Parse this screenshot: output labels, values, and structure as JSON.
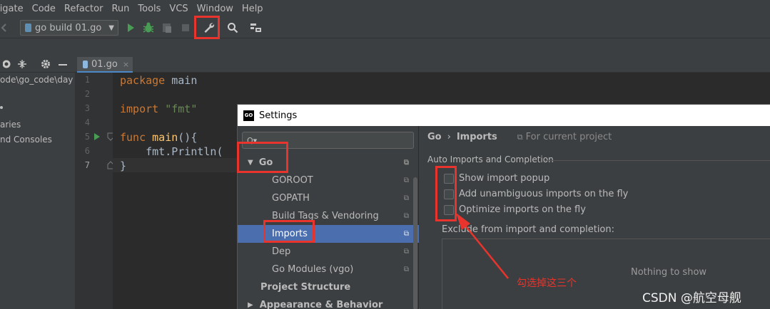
{
  "menu": {
    "items": [
      "vigate",
      "Code",
      "Refactor",
      "Run",
      "Tools",
      "VCS",
      "Window",
      "Help"
    ]
  },
  "toolbar": {
    "run_config_label": "go build 01.go",
    "icons": [
      "run-icon",
      "debug-icon",
      "coverage-icon",
      "stop-icon",
      "wrench-icon",
      "search-icon",
      "structure-icon"
    ]
  },
  "editor_tab": {
    "label": "01.go"
  },
  "project_panel": {
    "path": "ode\\go_code\\day",
    "items": [
      "aries",
      "nd Consoles"
    ]
  },
  "editor": {
    "lines": [
      {
        "num": "1",
        "tokens": [
          {
            "t": "package",
            "c": "kw"
          },
          {
            "t": " main",
            "c": ""
          }
        ]
      },
      {
        "num": "2",
        "tokens": []
      },
      {
        "num": "3",
        "tokens": [
          {
            "t": "import",
            "c": "kw"
          },
          {
            "t": " ",
            "c": ""
          },
          {
            "t": "\"fmt\"",
            "c": "str"
          }
        ]
      },
      {
        "num": "4",
        "tokens": []
      },
      {
        "num": "5",
        "tokens": [
          {
            "t": "func",
            "c": "kw"
          },
          {
            "t": " ",
            "c": ""
          },
          {
            "t": "main",
            "c": "fn"
          },
          {
            "t": "(){",
            "c": ""
          }
        ]
      },
      {
        "num": "6",
        "tokens": [
          {
            "t": "    fmt.Println(",
            "c": ""
          }
        ]
      },
      {
        "num": "7",
        "tokens": [
          {
            "t": "}",
            "c": ""
          }
        ]
      }
    ]
  },
  "dialog": {
    "title": "Settings",
    "search_placeholder": "Q▾",
    "tree": [
      {
        "label": "Go",
        "expanded": true
      },
      {
        "label": "GOROOT"
      },
      {
        "label": "GOPATH"
      },
      {
        "label": "Build Tags & Vendoring"
      },
      {
        "label": "Imports",
        "selected": true
      },
      {
        "label": "Dep"
      },
      {
        "label": "Go Modules (vgo)"
      },
      {
        "label": "Project Structure"
      },
      {
        "label": "Appearance & Behavior"
      }
    ],
    "breadcrumb": {
      "parent": "Go",
      "separator": "›",
      "current": "Imports",
      "scope": "For current project"
    },
    "section_title": "Auto Imports and Completion",
    "options": [
      {
        "label": "Show import popup",
        "checked": false
      },
      {
        "label": "Add unambiguous imports on the fly",
        "checked": false
      },
      {
        "label": "Optimize imports on the fly",
        "checked": false
      }
    ],
    "exclude_label": "Exclude from import and completion:",
    "empty_text": "Nothing to show"
  },
  "annotation": {
    "text": "勾选掉这三个",
    "color": "#e8342c"
  },
  "watermark": "CSDN @航空母舰",
  "colors": {
    "accent_selection": "#4b6eaf",
    "annotation_red": "#e8342c",
    "run_green": "#499c54",
    "keyword": "#cc7832",
    "string": "#6a8759"
  }
}
